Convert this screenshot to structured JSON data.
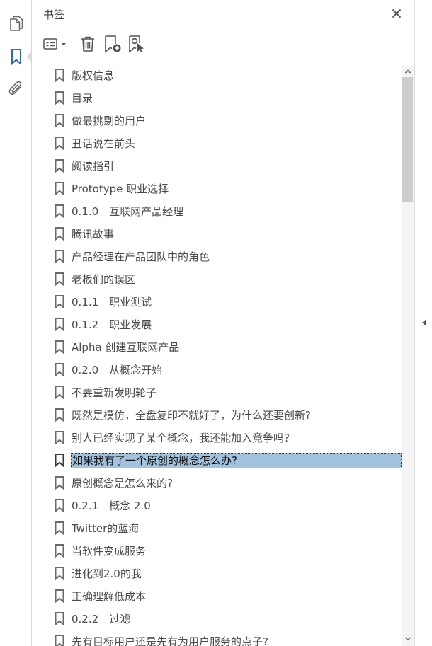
{
  "panel": {
    "title": "书签"
  },
  "left_toolbar": {
    "items": [
      {
        "icon": "pages-icon"
      },
      {
        "icon": "bookmark-icon",
        "active": true
      },
      {
        "icon": "attachment-icon"
      }
    ]
  },
  "toolbar": {
    "buttons": [
      {
        "icon": "options-menu-icon"
      },
      {
        "icon": "delete-icon"
      },
      {
        "icon": "new-bookmark-icon"
      },
      {
        "icon": "bookmark-from-selection-icon"
      }
    ]
  },
  "colors": {
    "selected_bg": "#a1c3de",
    "icon_gray": "#6b6b6b",
    "active_blue": "#2b6cb0"
  },
  "bookmarks": [
    {
      "label": "版权信息"
    },
    {
      "label": "目录"
    },
    {
      "label": "做最挑剔的用户"
    },
    {
      "label": "丑话说在前头"
    },
    {
      "label": "阅读指引"
    },
    {
      "label": "Prototype 职业选择"
    },
    {
      "label": "0.1.0　互联网产品经理"
    },
    {
      "label": "腾讯故事"
    },
    {
      "label": "产品经理在产品团队中的角色"
    },
    {
      "label": "老板们的误区"
    },
    {
      "label": "0.1.1　职业测试"
    },
    {
      "label": "0.1.2　职业发展"
    },
    {
      "label": "Alpha 创建互联网产品"
    },
    {
      "label": "0.2.0　从概念开始"
    },
    {
      "label": "不要重新发明轮子"
    },
    {
      "label": "既然是模仿，全盘复印不就好了，为什么还要创新?"
    },
    {
      "label": "别人已经实现了某个概念，我还能加入竞争吗?"
    },
    {
      "label": "如果我有了一个原创的概念怎么办?",
      "selected": true
    },
    {
      "label": "原创概念是怎么来的?"
    },
    {
      "label": "0.2.1　概念 2.0"
    },
    {
      "label": "Twitter的蓝海"
    },
    {
      "label": "当软件变成服务"
    },
    {
      "label": "进化到2.0的我"
    },
    {
      "label": "正确理解低成本"
    },
    {
      "label": "0.2.2　过滤"
    },
    {
      "label": "先有目标用户还是先有为用户服务的点子?"
    }
  ]
}
